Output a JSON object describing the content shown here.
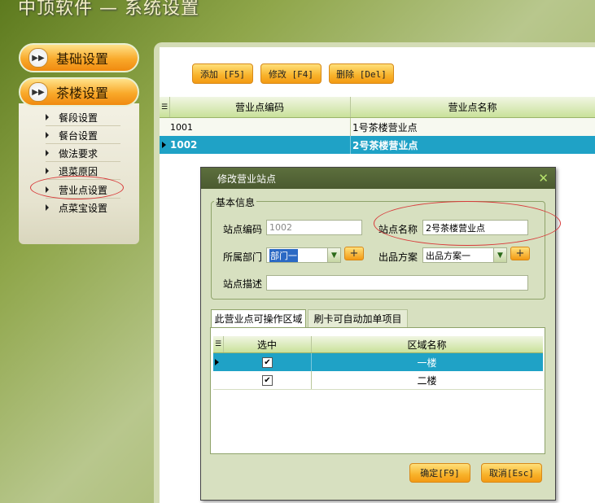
{
  "app": {
    "title": "中顶软件 — 系统设置"
  },
  "sidebar": {
    "basic_settings": "基础设置",
    "teahouse_settings": "茶楼设置",
    "items": [
      {
        "label": "餐段设置"
      },
      {
        "label": "餐台设置"
      },
      {
        "label": "做法要求"
      },
      {
        "label": "退菜原因"
      },
      {
        "label": "营业点设置"
      },
      {
        "label": "点菜宝设置"
      }
    ]
  },
  "toolbar": {
    "add": "添加 [F5]",
    "edit": "修改 [F4]",
    "delete": "删除 [Del]"
  },
  "grid": {
    "columns": [
      "营业点编码",
      "营业点名称"
    ],
    "rows": [
      {
        "code": "1001",
        "name": "1号茶楼营业点"
      },
      {
        "code": "1002",
        "name": "2号茶楼营业点"
      }
    ]
  },
  "dialog": {
    "title": "修改营业站点",
    "group_label": "基本信息",
    "station_code_label": "站点编码",
    "station_code_value": "1002",
    "station_name_label": "站点名称",
    "station_name_value": "2号茶楼营业点",
    "department_label": "所属部门",
    "department_value": "部门一",
    "product_plan_label": "出品方案",
    "product_plan_value": "出品方案一",
    "description_label": "站点描述",
    "description_value": "",
    "plus": "+",
    "tabs": [
      "此营业点可操作区域",
      "刷卡可自动加单项目"
    ],
    "sub_columns": [
      "选中",
      "区域名称"
    ],
    "sub_rows": [
      {
        "checked": "✔",
        "name": "一楼"
      },
      {
        "checked": "✔",
        "name": "二楼"
      }
    ],
    "ok": "确定[F9]",
    "cancel": "取消[Esc]"
  },
  "colors": {
    "accent_orange": "#f8b22a",
    "selected_row": "#1fa2c6",
    "dialog_title": "#4b5a30"
  }
}
